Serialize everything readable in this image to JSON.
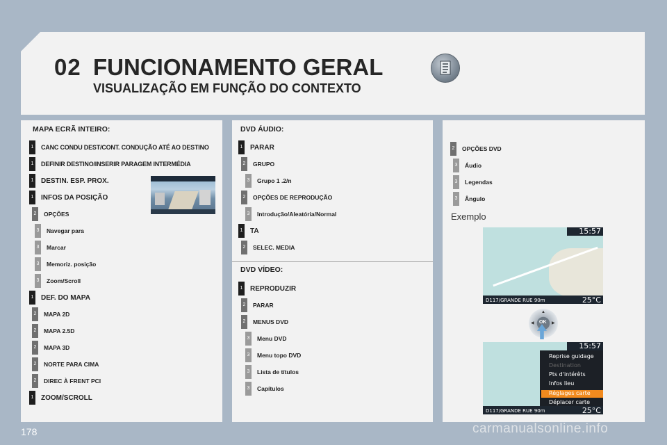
{
  "header": {
    "chapter": "02",
    "title": "FUNCIONAMENTO GERAL",
    "subtitle": "VISUALIZAÇÃO EM FUNÇÃO DO CONTEXTO",
    "icon": "document-list-icon"
  },
  "map_section": {
    "title": "MAPA ECRÃ INTEIRO:",
    "items": [
      {
        "level": "1",
        "label": "CANC CONDU DEST/CONT. CONDUÇÃO ATÉ AO DESTINO"
      },
      {
        "level": "1",
        "label": "DEFINIR DESTINO/INSERIR PARAGEM INTERMÉDIA"
      },
      {
        "level": "1",
        "label": "DESTIN. ESP. PROX."
      },
      {
        "level": "1",
        "label": "INFOS DA POSIÇÃO"
      },
      {
        "level": "2",
        "label": "OPÇÕES"
      },
      {
        "level": "3",
        "label": "Navegar para"
      },
      {
        "level": "3",
        "label": "Marcar"
      },
      {
        "level": "3",
        "label": "Memoriz. posição"
      },
      {
        "level": "3",
        "label": "Zoom/Scroll"
      },
      {
        "level": "1",
        "label": "DEF. DO MAPA"
      },
      {
        "level": "2",
        "label": "MAPA 2D"
      },
      {
        "level": "2",
        "label": "MAPA 2.5D"
      },
      {
        "level": "2",
        "label": "MAPA 3D"
      },
      {
        "level": "2",
        "label": "NORTE PARA CIMA"
      },
      {
        "level": "2",
        "label": "DIREC À FRENT PCI"
      },
      {
        "level": "1",
        "label": "ZOOM/SCROLL"
      }
    ]
  },
  "dvd_audio": {
    "title": "DVD ÁUDIO:",
    "items": [
      {
        "level": "1",
        "label": "PARAR"
      },
      {
        "level": "2",
        "label": "GRUPO"
      },
      {
        "level": "3",
        "label": "Grupo 1 .2/n"
      },
      {
        "level": "2",
        "label": "OPÇÕES DE REPRODUÇÃO"
      },
      {
        "level": "3",
        "label": "Introdução/Aleatória/Normal"
      },
      {
        "level": "1",
        "label": "TA"
      },
      {
        "level": "2",
        "label": "SELEC. MEDIA"
      }
    ]
  },
  "dvd_video": {
    "title": "DVD VÍDEO:",
    "items": [
      {
        "level": "1",
        "label": "REPRODUZIR"
      },
      {
        "level": "2",
        "label": "PARAR"
      },
      {
        "level": "2",
        "label": "MENUS DVD"
      },
      {
        "level": "3",
        "label": "Menu DVD"
      },
      {
        "level": "3",
        "label": "Menu topo DVD"
      },
      {
        "level": "3",
        "label": "Lista de títulos"
      },
      {
        "level": "3",
        "label": "Capítulos"
      }
    ]
  },
  "dvd_options": {
    "items": [
      {
        "level": "2",
        "label": "OPÇÕES DVD"
      },
      {
        "level": "3",
        "label": "Áudio"
      },
      {
        "level": "3",
        "label": "Legendas"
      },
      {
        "level": "3",
        "label": "Ângulo"
      }
    ]
  },
  "example": {
    "label": "Exemplo",
    "screen1": {
      "clock": "15:57",
      "street": "D117/GRANDE RUE",
      "distance": "90m",
      "temp": "25°C"
    },
    "screen2": {
      "clock": "15:57",
      "street": "D117/GRANDE RUE",
      "distance": "90m",
      "temp": "25°C",
      "menu": [
        "Reprise guidage",
        "Destination",
        "Pts d'intérêts",
        "Infos lieu",
        "Réglages carte",
        "Déplacer carte"
      ],
      "selected": "Réglages carte"
    },
    "knob_label": "OK"
  },
  "footer": {
    "page": "178",
    "watermark": "carmanualsonline.info"
  }
}
